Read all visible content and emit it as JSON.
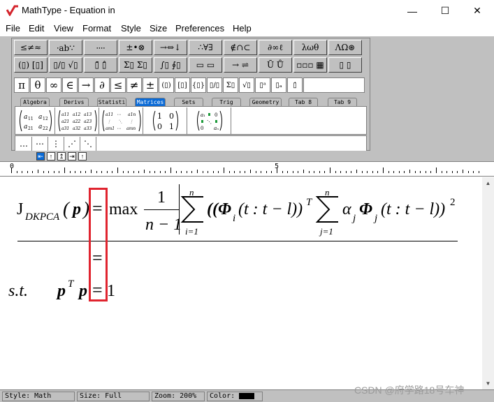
{
  "window": {
    "title": "MathType - Equation in",
    "minimize": "—",
    "maximize": "☐",
    "close": "✕"
  },
  "menu": [
    "File",
    "Edit",
    "View",
    "Format",
    "Style",
    "Size",
    "Preferences",
    "Help"
  ],
  "palette": {
    "row1": [
      "≤≠≈",
      "⸱ab∵",
      "⸱⸱⸱⸱",
      "±•⊗",
      "→⇔↓",
      "∴∀∃",
      "∉∩⊂",
      "∂∞ℓ",
      "λωθ",
      "ΛΩ⊛"
    ],
    "row2": [
      "(▯) [▯]",
      "▯/▯ √▯",
      "▯̄ ▯̂",
      "Σ▯ Σ▯",
      "∫▯ ∮▯",
      "▭ ▭",
      "→ ⇌",
      "Ū Ů",
      "▫▫▫ ▦",
      "▯ ▯"
    ],
    "row3": [
      "π",
      "θ",
      "∞",
      "∈",
      "→",
      "∂",
      "≤",
      "≠",
      "±",
      "(▯)",
      "[▯]",
      "{▯}",
      "▯/▯",
      "Σ▯",
      "√▯",
      "▯ᵃ",
      "▯ₐ",
      "▯̇"
    ],
    "tabs": [
      "Algebra",
      "Derivs",
      "Statisti",
      "Matrices",
      "Sets",
      "Trig",
      "Geometry",
      "Tab 8",
      "Tab 9"
    ],
    "active_tab": "Matrices",
    "matrix_templates": [
      "a11 a12 / a21 a22",
      "a11 a12 a13 / a21 a22 a23 / a31 a32 a33",
      "a11 … a1n / ⋮ ⋱ ⋮ / am1 … amn",
      "1 0 / 0 1",
      "a1 ⋮ 0 / 0 ⋱ an"
    ],
    "dots": [
      "…",
      "⋯",
      "⋮",
      "⋰",
      "⋱"
    ]
  },
  "tabstops": [
    "⇤",
    "↑",
    "↥",
    "⇥",
    "↑"
  ],
  "ruler": {
    "marks": [
      "0",
      "5"
    ]
  },
  "equation": {
    "line1": {
      "J": "J",
      "sub": "DKPCA",
      "lparen": "(",
      "p": "p",
      "rparen": ")",
      "eq": "=",
      "max": "max",
      "frac_num": "1",
      "frac_den": "n − 1",
      "sum1_top": "n",
      "sum1_bot": "i=1",
      "body1": "((Φ",
      "sub_i": "i",
      "arg1": "(t : t − l))",
      "sup_T": "T",
      "sum2_top": "n",
      "sum2_bot": "j=1",
      "alpha": "α",
      "sub_j1": "j",
      "phi2": "Φ",
      "sub_j2": "j",
      "arg2": "(t : t − l))",
      "sup_2": "2"
    },
    "line2": {
      "eq": "="
    },
    "line3": {
      "st": "s.t.",
      "p1": "p",
      "sup_T": "T",
      "p2": "p",
      "eq": "=",
      "one": "1"
    },
    "highlight_color": "#e0242f"
  },
  "status": {
    "style": "Style: Math",
    "size": "Size: Full",
    "zoom": "Zoom: 200%",
    "color": "Color:"
  },
  "watermark": "CSDN @府学路18号车神"
}
